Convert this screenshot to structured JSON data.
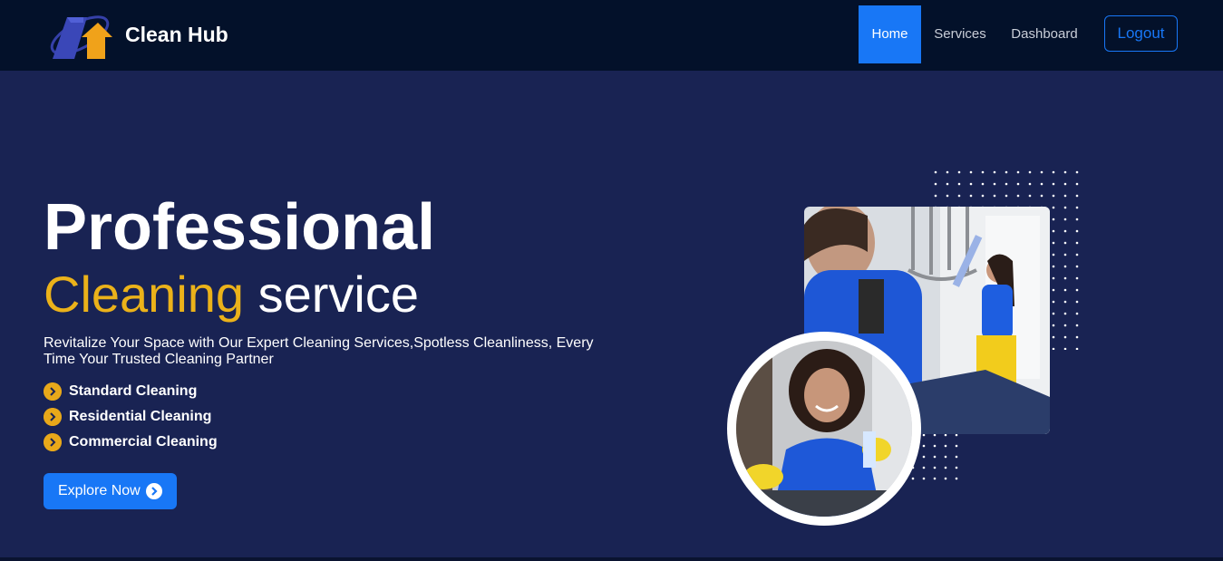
{
  "nav": {
    "brand": "Clean Hub",
    "home_label": "Home",
    "services_label": "Services",
    "dashboard_label": "Dashboard",
    "logout_label": "Logout"
  },
  "hero": {
    "title": "Professional",
    "subtitle_accent": "Cleaning",
    "subtitle_rest": "service",
    "description": "Revitalize Your Space with Our Expert Cleaning Services,Spotless Cleanliness, Every Time Your Trusted Cleaning Partner",
    "features": [
      {
        "label": "Standard Cleaning",
        "icon": "chevron-right-icon"
      },
      {
        "label": "Residential Cleaning",
        "icon": "chevron-right-icon"
      },
      {
        "label": "Commercial Cleaning",
        "icon": "chevron-right-icon"
      }
    ],
    "cta_label": "Explore Now",
    "cta_icon": "arrow-circle-right-icon"
  },
  "colors": {
    "navbar_bg": "#03112a",
    "hero_bg": "#192353",
    "accent_yellow": "#ebb21a",
    "primary_blue": "#1877f6"
  }
}
